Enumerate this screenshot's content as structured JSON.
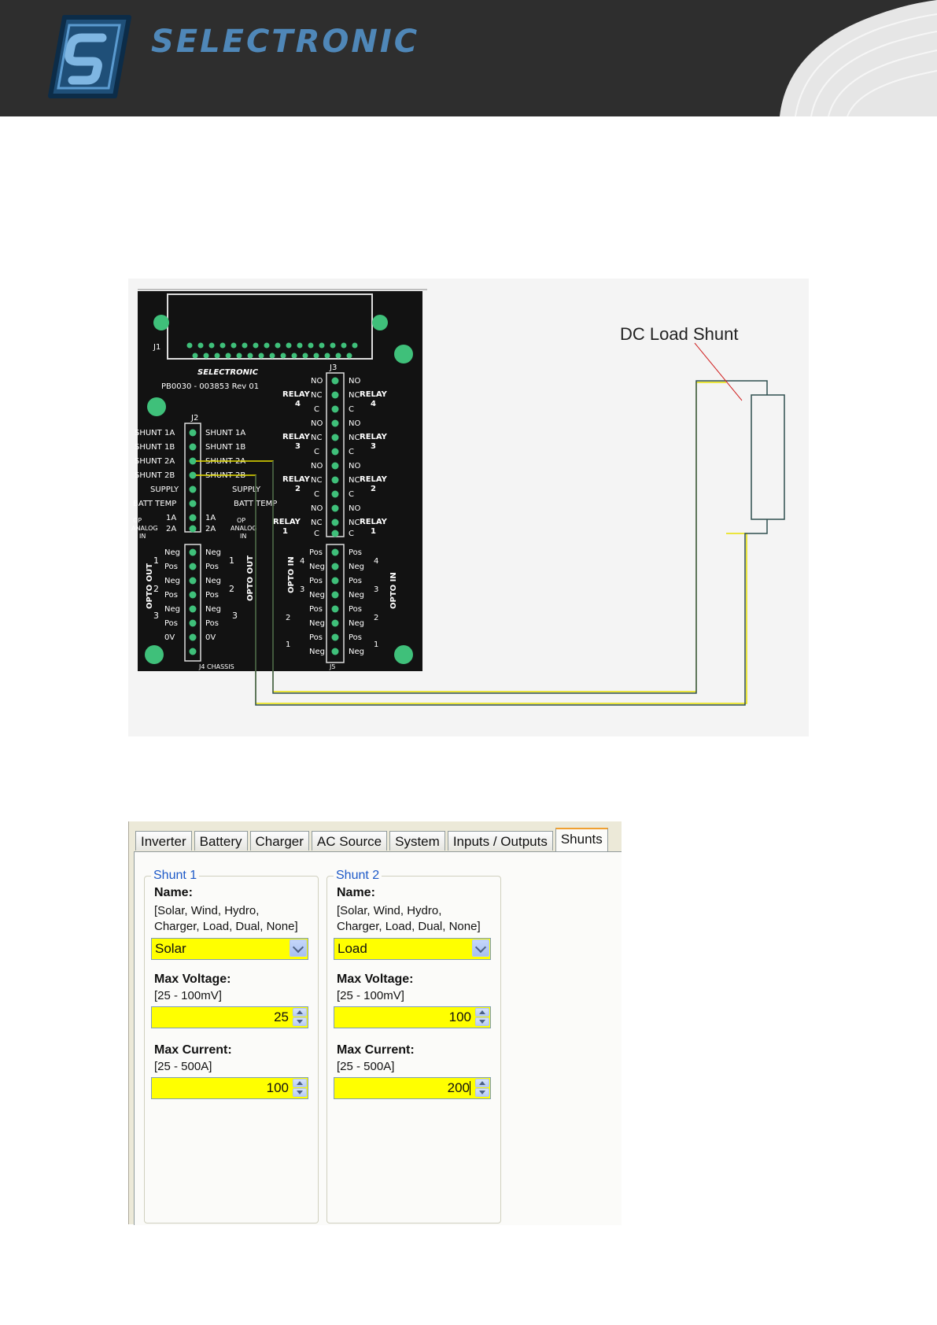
{
  "header": {
    "brand": "SELECTRONIC",
    "bg_color": "#2e2e2e",
    "brand_color": "#4f87b8"
  },
  "diagram": {
    "shunt_label": "DC Load Shunt",
    "pcb": {
      "brand": "SELECTRONIC",
      "part_number": "PB0030 - 003853 Rev 01",
      "connectors": [
        "J1",
        "J2",
        "J3",
        "J4",
        "J5"
      ],
      "j2_left_labels": [
        "SHUNT 1A",
        "SHUNT 1B",
        "SHUNT 2A",
        "SHUNT 2B",
        "SUPPLY",
        "BATT TEMP",
        "1A",
        "2A"
      ],
      "j2_right_labels": [
        "SHUNT 1A",
        "SHUNT 1B",
        "SHUNT 2A",
        "SHUNT 2B",
        "SUPPLY",
        "BATT TEMP",
        "1A",
        "2A"
      ],
      "analog_label_left": "OP ANALOG IN",
      "analog_label_right": "OP ANALOG OUT",
      "relays": [
        "RELAY 4",
        "RELAY 3",
        "RELAY 2",
        "RELAY 1"
      ],
      "relay_contacts": [
        "NO",
        "NC",
        "C"
      ],
      "j4_left": [
        "Neg",
        "Pos",
        "Neg",
        "Pos",
        "Neg",
        "Pos",
        "0V"
      ],
      "j4_right": [
        "Neg",
        "Pos",
        "Neg",
        "Pos",
        "Neg",
        "Pos",
        "0V"
      ],
      "j4_numbers": [
        "1",
        "2",
        "3"
      ],
      "opto_out": "OPTO OUT",
      "opto_in": "OPTO IN",
      "chassis": "CHASSIS",
      "j5_left": [
        "Pos",
        "Neg",
        "Pos",
        "Neg",
        "Pos",
        "Neg",
        "Pos",
        "Neg"
      ],
      "j5_right": [
        "Pos",
        "Neg",
        "Pos",
        "Neg",
        "Pos",
        "Neg",
        "Pos",
        "Neg"
      ],
      "j5_numbers": [
        "4",
        "3",
        "2",
        "1"
      ]
    },
    "wire_colors": {
      "sense": "#e8e000",
      "cable": "#2f4f4f",
      "pointer": "#d02020"
    }
  },
  "dialog": {
    "tabs": [
      {
        "label": "Inverter",
        "active": false
      },
      {
        "label": "Battery",
        "active": false
      },
      {
        "label": "Charger",
        "active": false
      },
      {
        "label": "AC Source",
        "active": false
      },
      {
        "label": "System",
        "active": false
      },
      {
        "label": "Inputs / Outputs",
        "active": false
      },
      {
        "label": "Shunts",
        "active": true
      }
    ],
    "shunts": [
      {
        "title": "Shunt 1",
        "name_label": "Name:",
        "name_hint_1": "[Solar, Wind, Hydro,",
        "name_hint_2": "Charger, Load, Dual, None]",
        "name_value": "Solar",
        "voltage_label": "Max Voltage:",
        "voltage_hint": "[25 - 100mV]",
        "voltage_value": "25",
        "current_label": "Max Current:",
        "current_hint": "[25 - 500A]",
        "current_value": "100"
      },
      {
        "title": "Shunt 2",
        "name_label": "Name:",
        "name_hint_1": "[Solar, Wind, Hydro,",
        "name_hint_2": "Charger, Load, Dual, None]",
        "name_value": "Load",
        "voltage_label": "Max Voltage:",
        "voltage_hint": "[25 - 100mV]",
        "voltage_value": "100",
        "current_label": "Max Current:",
        "current_hint": "[25 - 500A]",
        "current_value": "200"
      }
    ],
    "field_color": "#ffff00"
  }
}
